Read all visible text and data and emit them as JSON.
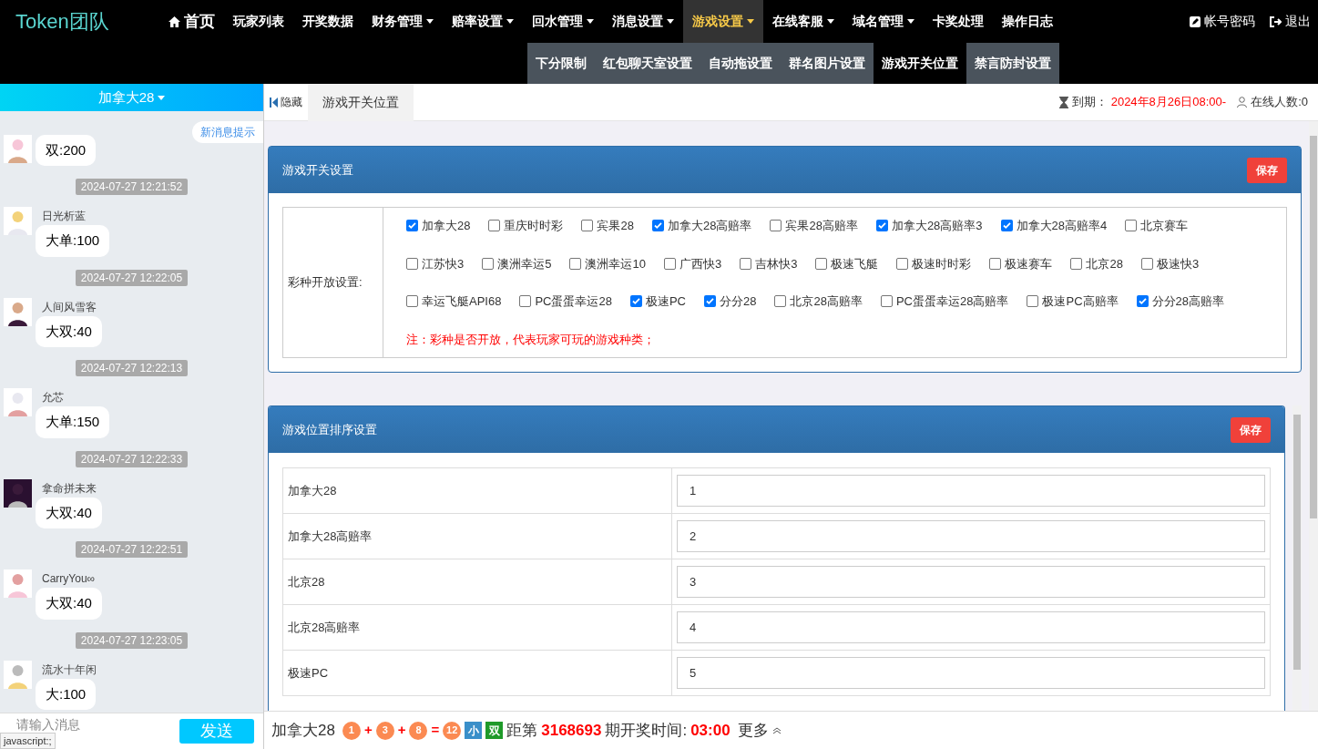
{
  "brand": "Token团队",
  "nav": [
    {
      "label": "首页",
      "dropdown": false,
      "selected": false
    },
    {
      "label": "玩家列表",
      "dropdown": false,
      "selected": false
    },
    {
      "label": "开奖数据",
      "dropdown": false,
      "selected": false
    },
    {
      "label": "财务管理",
      "dropdown": true,
      "selected": false
    },
    {
      "label": "赔率设置",
      "dropdown": true,
      "selected": false
    },
    {
      "label": "回水管理",
      "dropdown": true,
      "selected": false
    },
    {
      "label": "消息设置",
      "dropdown": true,
      "selected": false
    },
    {
      "label": "游戏设置",
      "dropdown": true,
      "selected": true
    },
    {
      "label": "在线客服",
      "dropdown": true,
      "selected": false
    },
    {
      "label": "域名管理",
      "dropdown": true,
      "selected": false
    },
    {
      "label": "卡奖处理",
      "dropdown": false,
      "selected": false
    },
    {
      "label": "操作日志",
      "dropdown": false,
      "selected": false
    }
  ],
  "nav_right": [
    {
      "label": "帐号密码"
    },
    {
      "label": "退出"
    }
  ],
  "subnav": [
    {
      "label": "下分限制",
      "selected": false
    },
    {
      "label": "红包聊天室设置",
      "selected": false
    },
    {
      "label": "自动拖设置",
      "selected": false
    },
    {
      "label": "群名图片设置",
      "selected": false
    },
    {
      "label": "游戏开关位置",
      "selected": true
    },
    {
      "label": "禁言防封设置",
      "selected": false
    }
  ],
  "chat": {
    "room": "加拿大28",
    "new_msg": "新消息提示",
    "messages": [
      {
        "text": "双:200"
      },
      {
        "time": "2024-07-27 12:21:52",
        "name": "日光析蓝",
        "text": "大单:100"
      },
      {
        "time": "2024-07-27 12:22:05",
        "name": "人间风雪客",
        "text": "大双:40"
      },
      {
        "time": "2024-07-27 12:22:13",
        "name": "允芯",
        "text": "大单:150"
      },
      {
        "time": "2024-07-27 12:22:33",
        "name": "拿命拼未来",
        "text": "大双:40"
      },
      {
        "time": "2024-07-27 12:22:51",
        "name": "CarryYou∞",
        "text": "大双:40"
      },
      {
        "time": "2024-07-27 12:23:05",
        "name": "流水十年闲",
        "text": "大:100"
      }
    ],
    "placeholder": "请输入消息",
    "send": "发送"
  },
  "tabbar": {
    "hide": "隐藏",
    "tab": "游戏开关位置",
    "expire_label": "到期：",
    "expire": "2024年8月26日08:00-",
    "online": "在线人数:0"
  },
  "switch_panel": {
    "title": "游戏开关设置",
    "save": "保存",
    "row_label": "彩种开放设置:",
    "games": [
      {
        "label": "加拿大28",
        "checked": true
      },
      {
        "label": "重庆时时彩",
        "checked": false
      },
      {
        "label": "宾果28",
        "checked": false
      },
      {
        "label": "加拿大28高赔率",
        "checked": true
      },
      {
        "label": "宾果28高赔率",
        "checked": false
      },
      {
        "label": "加拿大28高赔率3",
        "checked": true
      },
      {
        "label": "加拿大28高赔率4",
        "checked": true
      },
      {
        "label": "北京赛车",
        "checked": false
      },
      {
        "label": "江苏快3",
        "checked": false
      },
      {
        "label": "澳洲幸运5",
        "checked": false
      },
      {
        "label": "澳洲幸运10",
        "checked": false
      },
      {
        "label": "广西快3",
        "checked": false
      },
      {
        "label": "吉林快3",
        "checked": false
      },
      {
        "label": "极速飞艇",
        "checked": false
      },
      {
        "label": "极速时时彩",
        "checked": false
      },
      {
        "label": "极速赛车",
        "checked": false
      },
      {
        "label": "北京28",
        "checked": false
      },
      {
        "label": "极速快3",
        "checked": false
      },
      {
        "label": "幸运飞艇API68",
        "checked": false
      },
      {
        "label": "PC蛋蛋幸运28",
        "checked": false
      },
      {
        "label": "极速PC",
        "checked": true
      },
      {
        "label": "分分28",
        "checked": true
      },
      {
        "label": "北京28高赔率",
        "checked": false
      },
      {
        "label": "PC蛋蛋幸运28高赔率",
        "checked": false
      },
      {
        "label": "极速PC高赔率",
        "checked": false
      },
      {
        "label": "分分28高赔率",
        "checked": true
      }
    ],
    "note": "注：彩种是否开放，代表玩家可玩的游戏种类；"
  },
  "order_panel": {
    "title": "游戏位置排序设置",
    "save": "保存",
    "rows": [
      {
        "name": "加拿大28",
        "value": "1"
      },
      {
        "name": "加拿大28高赔率",
        "value": "2"
      },
      {
        "name": "北京28",
        "value": "3"
      },
      {
        "name": "北京28高赔率",
        "value": "4"
      },
      {
        "name": "极速PC",
        "value": "5"
      }
    ]
  },
  "result_bar": {
    "game": "加拿大28",
    "balls": [
      "1",
      "+",
      "3",
      "+",
      "8",
      "=",
      "12"
    ],
    "tags": [
      {
        "label": "小",
        "color": "#3a8fc9"
      },
      {
        "label": "双",
        "color": "#1f9a2a"
      }
    ],
    "prefix": "距第",
    "issue": "3168693",
    "suffix": "期开奖时间:",
    "countdown": "03:00",
    "more": "更多"
  },
  "status_url": "javascript:;"
}
